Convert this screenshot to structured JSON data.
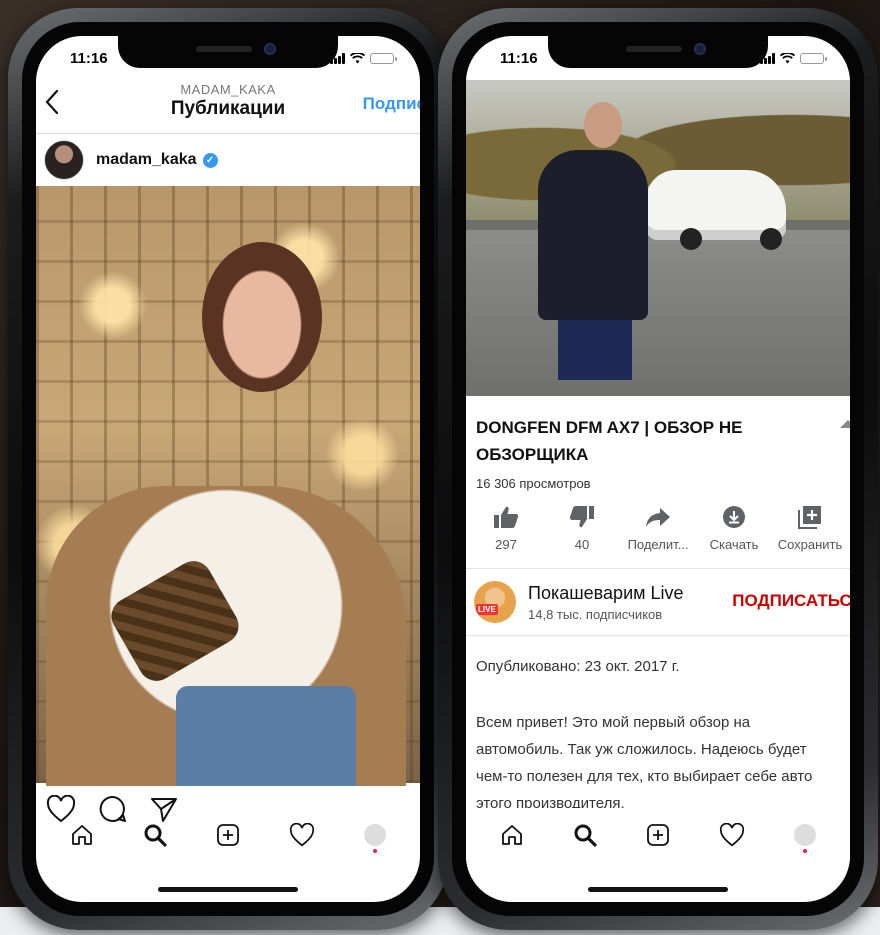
{
  "left_phone": {
    "status": {
      "time": "11:16"
    },
    "header": {
      "username": "MADAM_KAKA",
      "title": "Публикации",
      "follow_label": "Подпис"
    },
    "post": {
      "username": "madam_kaka",
      "verified": true
    },
    "actions": [
      "like-icon",
      "comment-icon",
      "share-icon"
    ],
    "tabbar": [
      "home-icon",
      "search-icon",
      "add-icon",
      "activity-icon",
      "profile-icon"
    ]
  },
  "right_phone": {
    "status": {
      "time": "11:16"
    },
    "video": {
      "title": "DONGFEN DFM AX7 | ОБЗОР НЕ ОБЗОРЩИКА",
      "views": "16 306 просмотров",
      "actions": [
        {
          "icon": "thumbs-up-icon",
          "label": "297"
        },
        {
          "icon": "thumbs-down-icon",
          "label": "40"
        },
        {
          "icon": "share-arrow-icon",
          "label": "Поделит..."
        },
        {
          "icon": "download-icon",
          "label": "Скачать"
        },
        {
          "icon": "save-playlist-icon",
          "label": "Сохранить"
        }
      ]
    },
    "channel": {
      "name": "Покашеварим Live",
      "subscribers": "14,8 тыс. подписчиков",
      "avatar_badge": "LIVE",
      "subscribe_label": "ПОДПИСАТЬСЯ"
    },
    "published": "Опубликовано: 23 окт. 2017 г.",
    "description": "Всем привет! Это мой первый обзор на автомобиль. Так уж сложилось. Надеюсь будет чем-то полезен для тех, кто выбирает себе авто этого производителя.",
    "tabbar": [
      "home-icon",
      "search-icon",
      "add-icon",
      "activity-icon",
      "profile-icon"
    ]
  },
  "colors": {
    "instagram_blue": "#3897f0",
    "youtube_red": "#cc0000",
    "battery_yellow": "#f5c400"
  }
}
